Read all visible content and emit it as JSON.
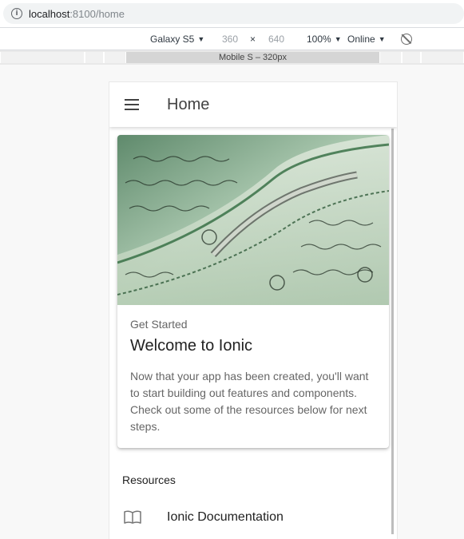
{
  "browser": {
    "url_host": "localhost",
    "url_path": ":8100/home"
  },
  "device_toolbar": {
    "device": "Galaxy S5",
    "width": "360",
    "times": "×",
    "height": "640",
    "zoom": "100%",
    "network": "Online",
    "dropdown_arrow": "▼",
    "media_query_label": "Mobile S – 320px"
  },
  "app": {
    "page_title": "Home",
    "card": {
      "subtitle": "Get Started",
      "title": "Welcome to Ionic",
      "body": "Now that your app has been created, you'll want to start building out features and components. Check out some of the resources below for next steps."
    },
    "resources": {
      "header": "Resources",
      "items": [
        {
          "icon": "book-icon",
          "label": "Ionic Documentation"
        }
      ]
    }
  },
  "colors": {
    "toolbar_text": "#424242",
    "body_text": "#666666",
    "image_green": "#6f9a7e"
  }
}
